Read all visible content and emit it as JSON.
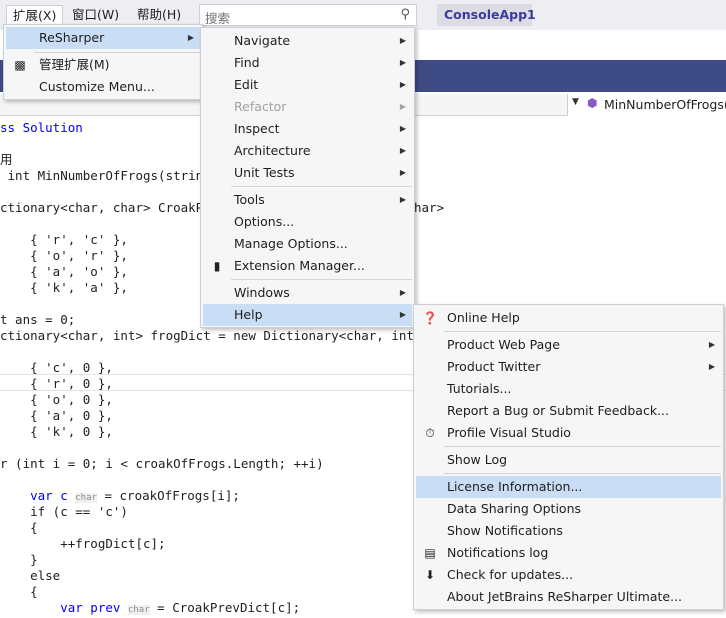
{
  "menubar": {
    "items": [
      {
        "label": "扩展(X)",
        "active": true
      },
      {
        "label": "窗口(W)"
      },
      {
        "label": "帮助(H)"
      }
    ],
    "search_placeholder": "搜索",
    "app_name": "ConsoleApp1"
  },
  "nav": {
    "member": "MinNumberOfFrogs("
  },
  "code": {
    "lines": [
      "ss Solution",
      "用",
      " int MinNumberOfFrogs(string",
      "ctionary<char, char> CroakPre",
      "    { 'r', 'c' },",
      "    { 'o', 'r' },",
      "    { 'a', 'o' },",
      "    { 'k', 'a' },",
      "t ans = 0;",
      "ctionary<char, int> frogDict = new Dictionary<char, int>",
      "    { 'c', 0 },",
      "    { 'r', 0 },",
      "    { 'o', 0 },",
      "    { 'a', 0 },",
      "    { 'k', 0 },",
      "r (int i = 0; i < croakOfFrogs.Length; ++i)",
      "    var c",
      " = croakOfFrogs[i];",
      "    if (c == 'c')",
      "    {",
      "        ++frogDict[c];",
      "    }",
      "    else",
      "    {",
      "        var prev",
      " = CroakPrevDict[c];",
      "har>"
    ],
    "hints": [
      "char",
      "char"
    ]
  },
  "extensions_menu": {
    "items": [
      {
        "label": "ReSharper"
      },
      {
        "label": "管理扩展(M)"
      },
      {
        "label": "Customize Menu..."
      }
    ]
  },
  "resharper_menu": {
    "items": [
      {
        "label": "Navigate"
      },
      {
        "label": "Find"
      },
      {
        "label": "Edit"
      },
      {
        "label": "Refactor"
      },
      {
        "label": "Inspect"
      },
      {
        "label": "Architecture"
      },
      {
        "label": "Unit Tests"
      },
      {
        "label": "Tools"
      },
      {
        "label": "Options..."
      },
      {
        "label": "Manage Options..."
      },
      {
        "label": "Extension Manager..."
      },
      {
        "label": "Windows"
      },
      {
        "label": "Help"
      }
    ]
  },
  "help_menu": {
    "items": [
      {
        "label": "Online Help"
      },
      {
        "label": "Product Web Page"
      },
      {
        "label": "Product Twitter"
      },
      {
        "label": "Tutorials..."
      },
      {
        "label": "Report a Bug or Submit Feedback..."
      },
      {
        "label": "Profile Visual Studio"
      },
      {
        "label": "Show Log"
      },
      {
        "label": "License Information..."
      },
      {
        "label": "Data Sharing Options"
      },
      {
        "label": "Show Notifications"
      },
      {
        "label": "Notifications log"
      },
      {
        "label": "Check for updates..."
      },
      {
        "label": "About JetBrains ReSharper Ultimate..."
      }
    ]
  },
  "colors": {
    "highlight": "#c9def5",
    "menu_bg": "#f6f6f6",
    "title_strip": "#3e4b85",
    "keyword": "#0000ff",
    "type": "#2b91af",
    "string": "#a31515"
  }
}
